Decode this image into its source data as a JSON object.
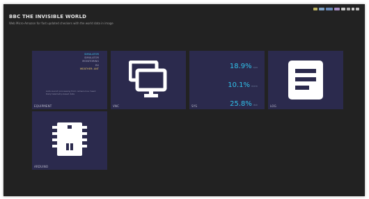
{
  "header": {
    "title": "BBC THE INVISIBLE WORLD",
    "subtitle": "Web Micro-Amazon for fast updated checkers with the world data in image"
  },
  "tiles": [
    {
      "label": "EQUIPMENT",
      "status_lines": [
        "SIMULATOR",
        "SIMULATOR",
        "MONITORING",
        "RX",
        "WEATHER: ANT"
      ],
      "note": "Auto-launch processing from camera live: Seed: Daily telemetry-based data"
    },
    {
      "label": "VNC"
    },
    {
      "label": "SYS",
      "metrics": [
        {
          "value": "18.9%",
          "unit": "cpu"
        },
        {
          "value": "10.1%",
          "unit": "mem"
        },
        {
          "value": "25.8%",
          "unit": "dsk"
        }
      ]
    },
    {
      "label": "LOG"
    },
    {
      "label": "ARDUINO"
    }
  ],
  "colors": {
    "page_bg": "#222222",
    "tile_bg": "#2b2a4d",
    "accent": "#31c1ea",
    "icon": "#ffffff"
  }
}
